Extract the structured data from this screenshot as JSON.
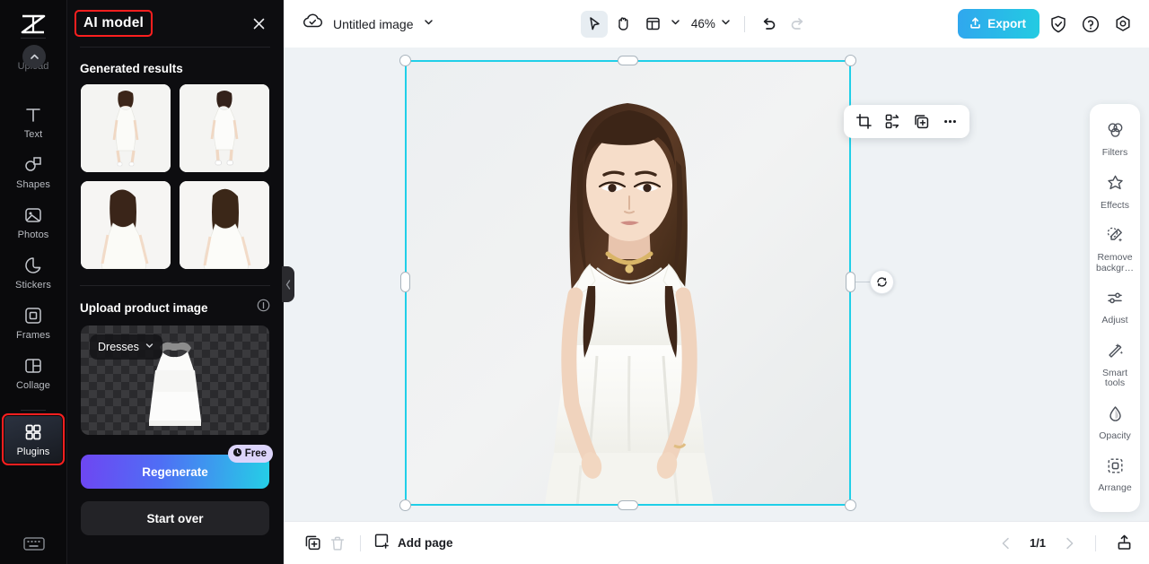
{
  "left_rail": {
    "logo_icon": "capcut-logo-icon",
    "upload": {
      "label": "Upload",
      "icon": "chevron-up-icon"
    },
    "items": [
      {
        "label": "Text",
        "icon": "text-icon",
        "selected": false
      },
      {
        "label": "Shapes",
        "icon": "shapes-icon",
        "selected": false
      },
      {
        "label": "Photos",
        "icon": "photos-icon",
        "selected": false
      },
      {
        "label": "Stickers",
        "icon": "stickers-icon",
        "selected": false
      },
      {
        "label": "Frames",
        "icon": "frames-icon",
        "selected": false
      },
      {
        "label": "Collage",
        "icon": "collage-icon",
        "selected": false
      },
      {
        "label": "Plugins",
        "icon": "plugins-grid-icon",
        "selected": true,
        "annotated": true
      }
    ],
    "keyboard_shortcut_icon": "keyboard-icon"
  },
  "panel": {
    "title": "AI model",
    "title_annotated": true,
    "close_icon": "close-icon",
    "generated_results": {
      "heading": "Generated results",
      "thumbnails": [
        {
          "name": "generated-result-1",
          "pose": "full-body-standing-heels"
        },
        {
          "name": "generated-result-2",
          "pose": "full-body-standing-sneakers"
        },
        {
          "name": "generated-result-3",
          "pose": "half-body-left"
        },
        {
          "name": "generated-result-4",
          "pose": "half-body-front"
        }
      ]
    },
    "upload_product": {
      "heading": "Upload product image",
      "info_icon": "info-icon",
      "category_value": "Dresses",
      "category_chevron_icon": "chevron-down-icon",
      "preview_name": "white-dress-cutout"
    },
    "regenerate": {
      "label": "Regenerate",
      "badge": "Free",
      "badge_icon": "clock-icon"
    },
    "start_over": {
      "label": "Start over"
    },
    "collapse_icon": "chevron-left-icon"
  },
  "topbar": {
    "cloud_icon": "cloud-check-icon",
    "doc_name": "Untitled image",
    "doc_chevron_icon": "chevron-down-icon",
    "tools": [
      {
        "name": "select-tool",
        "icon": "cursor-arrow-icon",
        "active": true
      },
      {
        "name": "hand-tool",
        "icon": "hand-icon",
        "active": false
      },
      {
        "name": "layout-tool",
        "icon": "layout-icon",
        "active": false
      }
    ],
    "layout_chevron_icon": "chevron-down-icon",
    "zoom_value": "46%",
    "zoom_chevron_icon": "chevron-down-icon",
    "undo_icon": "undo-icon",
    "redo_icon": "redo-icon",
    "export": {
      "label": "Export",
      "icon": "upload-share-icon"
    },
    "shield_icon": "shield-check-icon",
    "help_icon": "question-circle-icon",
    "settings_icon": "gear-hex-icon"
  },
  "canvas": {
    "selection": {
      "rotate_icon": "rotate-icon",
      "handles": [
        "top-left",
        "top-right",
        "bottom-left",
        "bottom-right",
        "left-mid",
        "right-mid",
        "top-mid",
        "bottom-mid"
      ]
    },
    "float_toolbar": [
      {
        "name": "crop-button",
        "icon": "crop-icon"
      },
      {
        "name": "cutout-button",
        "icon": "cutout-icon"
      },
      {
        "name": "duplicate-button",
        "icon": "duplicate-icon"
      },
      {
        "name": "more-options-button",
        "icon": "ellipsis-icon"
      }
    ],
    "image_name": "model-in-white-dress"
  },
  "right_tools": [
    {
      "label": "Filters",
      "icon": "filters-icon"
    },
    {
      "label": "Effects",
      "icon": "effects-star-icon"
    },
    {
      "label": "Remove backgr…",
      "icon": "remove-background-icon"
    },
    {
      "label": "Adjust",
      "icon": "adjust-sliders-icon"
    },
    {
      "label": "Smart tools",
      "icon": "magic-wand-icon"
    },
    {
      "label": "Opacity",
      "icon": "opacity-drop-icon"
    },
    {
      "label": "Arrange",
      "icon": "arrange-icon"
    }
  ],
  "bottombar": {
    "duplicate_page_icon": "duplicate-page-icon",
    "delete_page_icon": "trash-icon",
    "add_page": {
      "label": "Add page",
      "icon": "plus-square-icon"
    },
    "prev_icon": "chevron-left-icon",
    "page_indicator": "1/1",
    "next_icon": "chevron-right-icon",
    "export_page_icon": "upload-tray-icon"
  },
  "colors": {
    "accent_cyan": "#20cfe8",
    "export_gradient_from": "#30a7ee",
    "export_gradient_to": "#23cbe2",
    "regen_gradient_from": "#6e46f2",
    "regen_gradient_to": "#25cfe6",
    "annotation_red": "#ff1f1f",
    "panel_bg": "#0d0d10",
    "canvas_bg": "#eef2f5"
  }
}
